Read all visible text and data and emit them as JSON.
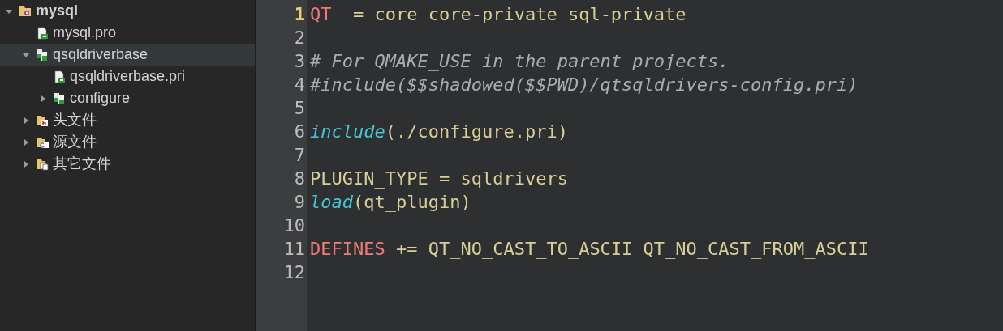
{
  "project_tree": [
    {
      "label": "mysql",
      "kind": "project",
      "expanded": true,
      "selected": false,
      "children": [
        {
          "label": "mysql.pro",
          "kind": "qt-file",
          "selected": false
        },
        {
          "label": "qsqldriverbase",
          "kind": "file-group",
          "expanded": true,
          "selected": true,
          "children": [
            {
              "label": "qsqldriverbase.pri",
              "kind": "qt-file",
              "selected": false
            },
            {
              "label": "configure",
              "kind": "file-group",
              "expanded": false,
              "selected": false
            }
          ]
        },
        {
          "label": "头文件",
          "kind": "header-folder",
          "expanded": false,
          "selected": false
        },
        {
          "label": "源文件",
          "kind": "source-folder",
          "expanded": false,
          "selected": false
        },
        {
          "label": "其它文件",
          "kind": "other-folder",
          "expanded": false,
          "selected": false
        }
      ]
    }
  ],
  "editor": {
    "lines": [
      {
        "number": "1",
        "current": true,
        "tokens": [
          {
            "kind": "variable",
            "text": "QT"
          },
          {
            "kind": "plain",
            "text": "  = core core-private sql-private"
          }
        ]
      },
      {
        "number": "2",
        "current": false
      },
      {
        "number": "3",
        "current": false,
        "tokens": [
          {
            "kind": "comment",
            "text": "# For QMAKE_USE in the parent projects."
          }
        ]
      },
      {
        "number": "4",
        "current": false,
        "tokens": [
          {
            "kind": "comment",
            "text": "#include($$shadowed($$PWD)/qtsqldrivers-config.pri)"
          }
        ]
      },
      {
        "number": "5",
        "current": false
      },
      {
        "number": "6",
        "current": false,
        "tokens": [
          {
            "kind": "function",
            "text": "include"
          },
          {
            "kind": "plain",
            "text": "(./configure.pri)"
          }
        ]
      },
      {
        "number": "7",
        "current": false
      },
      {
        "number": "8",
        "current": false,
        "tokens": [
          {
            "kind": "plain",
            "text": "PLUGIN_TYPE = sqldrivers"
          }
        ]
      },
      {
        "number": "9",
        "current": false,
        "tokens": [
          {
            "kind": "function",
            "text": "load"
          },
          {
            "kind": "plain",
            "text": "(qt_plugin)"
          }
        ]
      },
      {
        "number": "10",
        "current": false
      },
      {
        "number": "11",
        "current": false,
        "tokens": [
          {
            "kind": "variable",
            "text": "DEFINES"
          },
          {
            "kind": "plain",
            "text": " += QT_NO_CAST_TO_ASCII QT_NO_CAST_FROM_ASCII"
          }
        ]
      },
      {
        "number": "12",
        "current": false
      }
    ]
  }
}
